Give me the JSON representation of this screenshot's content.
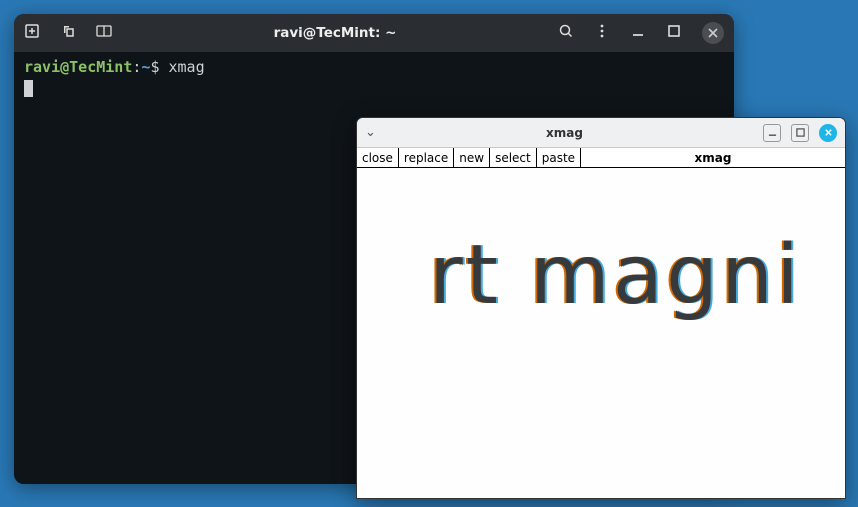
{
  "terminal": {
    "title": "ravi@TecMint: ~",
    "prompt": {
      "user": "ravi",
      "at": "@",
      "host": "TecMint",
      "colon": ":",
      "path": "~",
      "symbol": "$"
    },
    "command": "xmag"
  },
  "xmag": {
    "title": "xmag",
    "toolbar": {
      "close": "close",
      "replace": "replace",
      "new": "new",
      "select": "select",
      "paste": "paste",
      "label": "xmag"
    },
    "magnified_text": "rt magni"
  }
}
